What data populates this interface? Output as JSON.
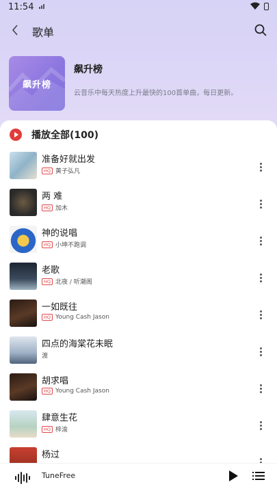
{
  "status": {
    "time": "11:54",
    "signal_icon": "signal-bars-icon"
  },
  "header": {
    "title": "歌单"
  },
  "playlist": {
    "cover_text": "飙升榜",
    "name": "飙升榜",
    "description": "云音乐中每天热度上升最快的100首单曲，每日更新。"
  },
  "play_all": {
    "label": "播放全部(100)"
  },
  "quality_badge": "HQ",
  "songs": [
    {
      "title": "准备好就出发",
      "artist": "黄子弘凡",
      "hq": true
    },
    {
      "title": "两 难",
      "artist": "加木",
      "hq": true
    },
    {
      "title": "神的说唱",
      "artist": "小坤不跑调",
      "hq": true
    },
    {
      "title": "老歌",
      "artist": "北夜 / 听潮阁",
      "hq": true
    },
    {
      "title": "一如既往",
      "artist": "Young Cash Jason",
      "hq": true
    },
    {
      "title": "四点的海棠花未眠",
      "artist": "渡",
      "hq": false
    },
    {
      "title": "胡求唱",
      "artist": "Young Cash Jason",
      "hq": true
    },
    {
      "title": "肆意生花",
      "artist": "梓渝",
      "hq": true
    },
    {
      "title": "杨过",
      "artist": "",
      "hq": false
    }
  ],
  "player": {
    "title": "TuneFree"
  },
  "colors": {
    "accent": "#e23b3b",
    "hero_bg": "#d9d4f7",
    "cover": "#8c77e0"
  }
}
